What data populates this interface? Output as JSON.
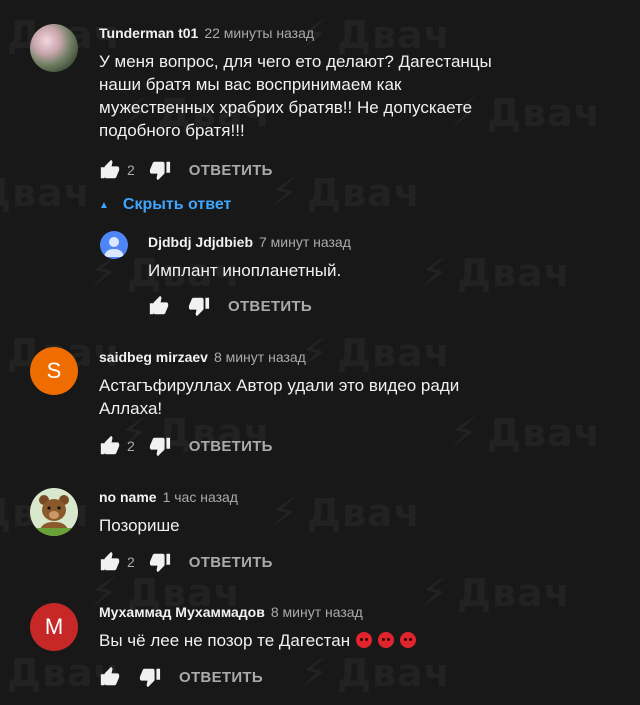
{
  "watermark": {
    "text": "Двач"
  },
  "comments": [
    {
      "author": "Tunderman t01",
      "time": "22 минуты назад",
      "text": "У меня вопрос, для чего ето делают? Дагестанцы наши братя мы вас воспринимаем как мужественных храбрих братяв!! Не допускаете подобного братя!!!",
      "likes": "2",
      "reply_label": "ОТВЕТИТЬ",
      "avatar_color": "#8a8a8a"
    },
    {
      "author": "saidbeg mirzaev",
      "time": "8 минут назад",
      "text": "Астагъфируллах Автор удали это видео ради Аллаха!",
      "likes": "2",
      "reply_label": "ОТВЕТИТЬ",
      "avatar_letter": "S",
      "avatar_color": "#ef6c00"
    },
    {
      "author": "no name",
      "time": "1 час назад",
      "text": "Позорише",
      "likes": "2",
      "reply_label": "ОТВЕТИТЬ",
      "avatar_color": "#cfe3c2"
    },
    {
      "author": "Мухаммад Мухаммадов",
      "time": "8 минут назад",
      "text": "Вы чё лее не позор те Дагестан",
      "reply_label": "ОТВЕТИТЬ",
      "avatar_letter": "M",
      "avatar_color": "#c62828"
    }
  ],
  "hide_replies_label": "Скрыть ответ",
  "reply": {
    "author": "Djdbdj Jdjdbieb",
    "time": "7 минут назад",
    "text": "Имплант инопланетный.",
    "reply_label": "ОТВЕТИТЬ",
    "avatar_color": "#4f86f7"
  },
  "colors": {
    "background": "#181818",
    "link": "#3ea6ff",
    "muted": "#aaaaaa"
  }
}
